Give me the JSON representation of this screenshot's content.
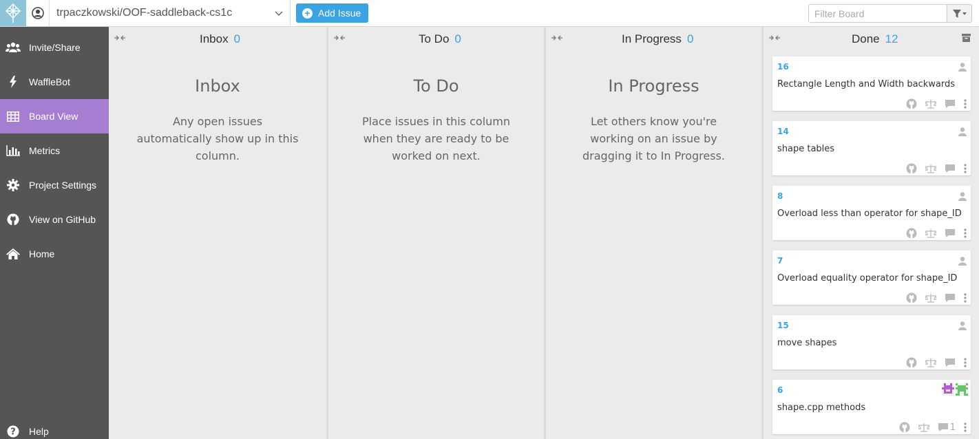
{
  "topbar": {
    "repo_name": "trpaczkowski/OOF-saddleback-cs1c",
    "add_issue_label": "Add Issue",
    "filter_placeholder": "Filter Board"
  },
  "sidebar": {
    "items": [
      {
        "label": "Invite/Share",
        "icon": "users-icon"
      },
      {
        "label": "WaffleBot",
        "icon": "bolt-icon"
      },
      {
        "label": "Board View",
        "icon": "grid-icon",
        "active": true
      },
      {
        "label": "Metrics",
        "icon": "bar-chart-icon"
      },
      {
        "label": "Project Settings",
        "icon": "gear-icon"
      },
      {
        "label": "View on GitHub",
        "icon": "github-icon"
      },
      {
        "label": "Home",
        "icon": "home-icon"
      }
    ],
    "help_label": "Help"
  },
  "columns": [
    {
      "name": "Inbox",
      "count": "0",
      "empty_title": "Inbox",
      "empty_desc": "Any open issues automatically show up in this column."
    },
    {
      "name": "To Do",
      "count": "0",
      "empty_title": "To Do",
      "empty_desc": "Place issues in this column when they are ready to be worked on next."
    },
    {
      "name": "In Progress",
      "count": "0",
      "empty_title": "In Progress",
      "empty_desc": "Let others know you're working on an issue by dragging it to In Progress."
    },
    {
      "name": "Done",
      "count": "12"
    }
  ],
  "cards": [
    {
      "number": "16",
      "title": "Rectangle Length and Width backwards"
    },
    {
      "number": "14",
      "title": "shape tables"
    },
    {
      "number": "8",
      "title": "Overload less than operator for shape_ID"
    },
    {
      "number": "7",
      "title": "Overload equality operator for shape_ID"
    },
    {
      "number": "15",
      "title": "move shapes"
    },
    {
      "number": "6",
      "title": "shape.cpp methods",
      "comments": "1"
    }
  ],
  "colors": {
    "accent": "#3aa3e3",
    "sidebar_bg": "#555555",
    "sidebar_active": "#a57ed3",
    "logo_bg": "#8dc4d8"
  }
}
